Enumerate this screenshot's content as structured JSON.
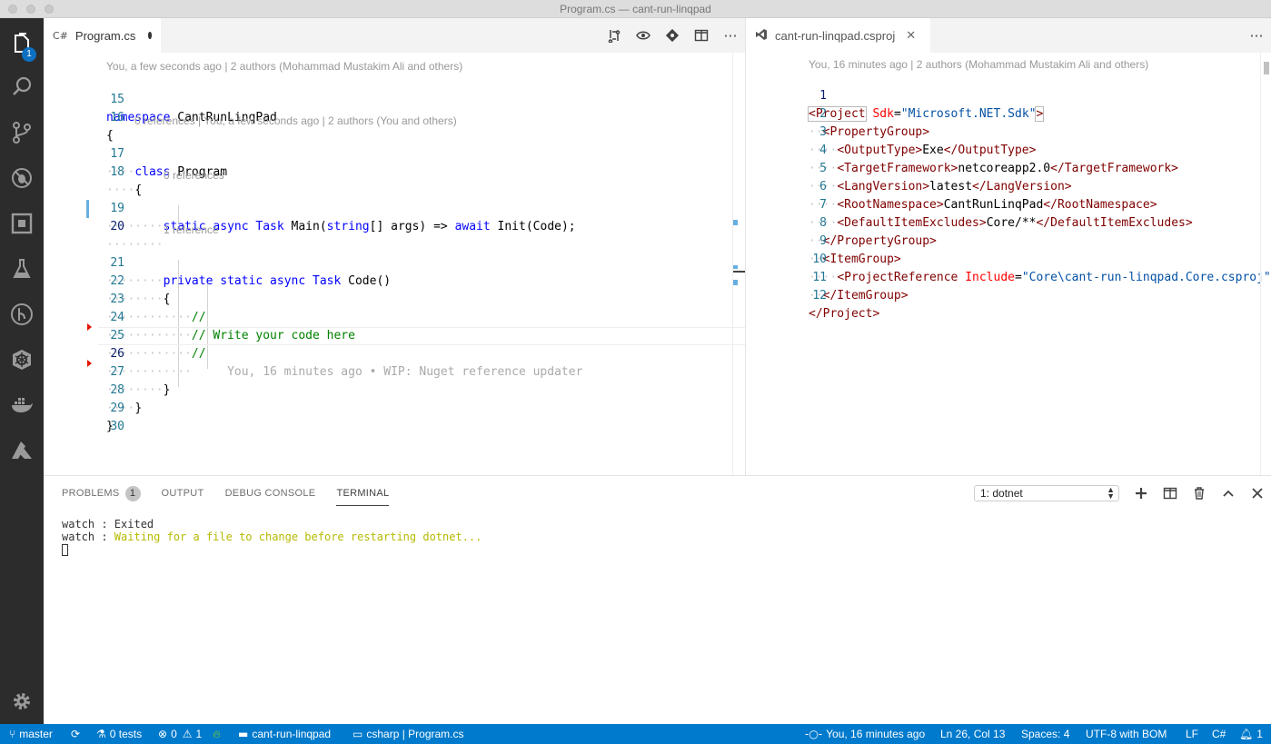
{
  "window": {
    "title": "Program.cs — cant-run-linqpad"
  },
  "activity_bar": {
    "explorer_badge": "1"
  },
  "left_editor": {
    "tab": {
      "lang_icon": "C#",
      "label": "Program.cs"
    },
    "lens_top": "You, a few seconds ago | 2 authors (Mohammad Mustakim Ali and others)",
    "lens_class": "0 references | You, a few seconds ago | 2 authors (You and others)",
    "lens_main": "0 references",
    "lens_code": "1 reference",
    "lines": {
      "l15": {
        "num": "15",
        "kw": "namespace",
        "rest": " CantRunLinqPad"
      },
      "l16": {
        "num": "16",
        "text": "{"
      },
      "l17": {
        "num": "17",
        "kw": "class",
        "rest": " Program"
      },
      "l18": {
        "num": "18",
        "text": "{"
      },
      "l19": {
        "num": "19",
        "k1": "static",
        "k2": "async",
        "t1": "Task",
        "t2": " Main(",
        "k3": "string",
        "t3": "[] args) => ",
        "k4": "await",
        "t4": " Init(Code);"
      },
      "l20": {
        "num": "20"
      },
      "l21": {
        "num": "21",
        "k1": "private",
        "k2": "static",
        "k3": "async",
        "k4": "Task",
        "t1": " Code()"
      },
      "l22": {
        "num": "22",
        "text": "{"
      },
      "l23": {
        "num": "23",
        "comment": "//"
      },
      "l24": {
        "num": "24",
        "comment": "// Write your code here"
      },
      "l25": {
        "num": "25",
        "comment": "//"
      },
      "l26": {
        "num": "26",
        "blame": "You, 16 minutes ago • WIP: Nuget reference updater"
      },
      "l27": {
        "num": "27",
        "text": "}"
      },
      "l28": {
        "num": "28",
        "text": "}"
      },
      "l29": {
        "num": "29",
        "text": "}"
      },
      "l30": {
        "num": "30"
      }
    }
  },
  "right_editor": {
    "tab": {
      "label": "cant-run-linqpad.csproj",
      "close": "✕"
    },
    "lens_top": "You, 16 minutes ago | 2 authors (Mohammad Mustakim Ali and others)",
    "lines": [
      {
        "num": "1"
      },
      {
        "num": "2"
      },
      {
        "num": "3"
      },
      {
        "num": "4"
      },
      {
        "num": "5"
      },
      {
        "num": "6"
      },
      {
        "num": "7"
      },
      {
        "num": "8"
      },
      {
        "num": "9"
      },
      {
        "num": "10"
      },
      {
        "num": "11"
      },
      {
        "num": "12"
      }
    ],
    "xml": {
      "project_open": "<Project",
      "sdk_attr": " Sdk",
      "sdk_val": "\"Microsoft.NET.Sdk\"",
      "gt": ">",
      "pg_open": "<PropertyGroup>",
      "ot_open": "<OutputType>",
      "ot_val": "Exe",
      "ot_close": "</OutputType>",
      "tf_open": "<TargetFramework>",
      "tf_val": "netcoreapp2.0",
      "tf_close": "</TargetFramework>",
      "lv_open": "<LangVersion>",
      "lv_val": "latest",
      "lv_close": "</LangVersion>",
      "rn_open": "<RootNamespace>",
      "rn_val": "CantRunLinqPad",
      "rn_close": "</RootNamespace>",
      "de_open": "<DefaultItemExcludes>",
      "de_val": "Core/**",
      "de_close": "</DefaultItemExcludes>",
      "pg_close": "</PropertyGroup>",
      "ig_open": "<ItemGroup>",
      "pr_open": "<ProjectReference",
      "pr_attr": " Include",
      "pr_val": "\"Core\\cant-run-linqpad.Core.csproj\"",
      "ig_close": "</ItemGroup>",
      "project_close": "</Project>"
    }
  },
  "panel": {
    "tabs": {
      "problems": "PROBLEMS",
      "problems_count": "1",
      "output": "OUTPUT",
      "debug": "DEBUG CONSOLE",
      "terminal": "TERMINAL"
    },
    "terminal_select": "1: dotnet",
    "terminal_lines": {
      "l1_prefix": "watch : ",
      "l1_text": "Exited",
      "l2_prefix": "watch : ",
      "l2_text": "Waiting for a file to change before restarting dotnet..."
    }
  },
  "status_bar": {
    "branch": "master",
    "tests": "0 tests",
    "errors": "0",
    "warnings": "1",
    "folder": "cant-run-linqpad",
    "project": "csharp | Program.cs",
    "blame": "You, 16 minutes ago",
    "position": "Ln 26, Col 13",
    "spaces": "Spaces: 4",
    "encoding": "UTF-8 with BOM",
    "eol": "LF",
    "language": "C#",
    "notifications": "1"
  },
  "colors": {
    "status_bar": "#007acc",
    "activity_bar": "#2c2c2c",
    "keyword": "#0000ff",
    "comment": "#008000",
    "xml_tag": "#800000",
    "xml_attr": "#ff0000",
    "xml_string": "#0451a5"
  }
}
